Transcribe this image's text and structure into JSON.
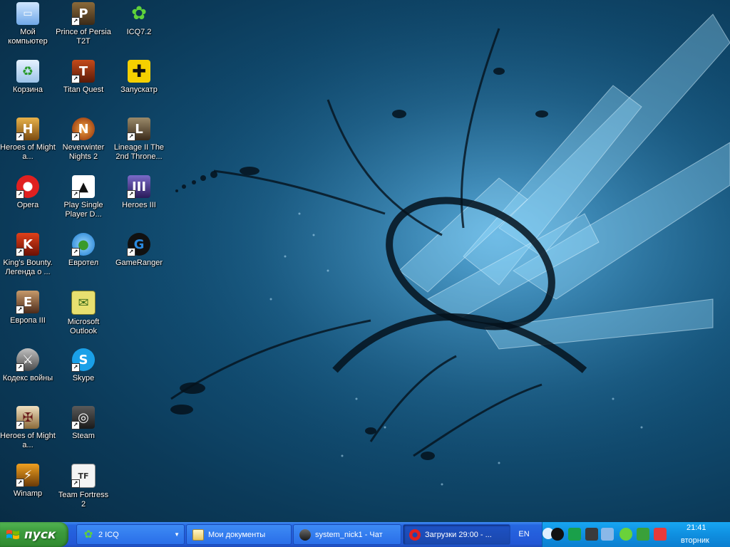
{
  "desktop": {
    "icons": [
      {
        "label": "Мой компьютер",
        "icon": "my-computer-icon"
      },
      {
        "label": "Prince of Persia T2T",
        "icon": "prince-of-persia-icon"
      },
      {
        "label": "ICQ7.2",
        "icon": "icq-flower-icon"
      },
      {
        "label": "Корзина",
        "icon": "recycle-bin-icon"
      },
      {
        "label": "Titan Quest",
        "icon": "titan-quest-icon"
      },
      {
        "label": "Запускатр",
        "icon": "zapuskatr-icon"
      },
      {
        "label": "Heroes of Might a...",
        "icon": "heroes-of-might-icon"
      },
      {
        "label": "Neverwinter Nights 2",
        "icon": "neverwinter-nights-icon"
      },
      {
        "label": "Lineage II The 2nd Throne...",
        "icon": "lineage-icon"
      },
      {
        "label": "Opera",
        "icon": "opera-icon"
      },
      {
        "label": "Play Single Player D...",
        "icon": "play-single-player-icon"
      },
      {
        "label": "Heroes III",
        "icon": "heroes-iii-icon"
      },
      {
        "label": "King's Bounty. Легенда о ...",
        "icon": "kings-bounty-icon"
      },
      {
        "label": "Евротел",
        "icon": "evrotel-globe-icon"
      },
      {
        "label": "GameRanger",
        "icon": "gameranger-icon"
      },
      {
        "label": "Европа III",
        "icon": "europa-iii-icon"
      },
      {
        "label": "Microsoft Outlook",
        "icon": "outlook-icon"
      },
      {
        "label": "Кодекс войны",
        "icon": "kodeks-voiny-icon"
      },
      {
        "label": "Skype",
        "icon": "skype-icon"
      },
      {
        "label": "Heroes of Might a...",
        "icon": "heroes-of-might-2-icon"
      },
      {
        "label": "Steam",
        "icon": "steam-icon"
      },
      {
        "label": "Winamp",
        "icon": "winamp-icon"
      },
      {
        "label": "Team Fortress 2",
        "icon": "team-fortress-icon"
      }
    ]
  },
  "taskbar": {
    "start_label": "пуск",
    "tasks": [
      {
        "label": "2 ICQ",
        "icon": "icq-flower-icon"
      },
      {
        "label": "Мои документы",
        "icon": "folder-icon"
      },
      {
        "label": "system_nick1 - Чат",
        "icon": "steam-icon"
      },
      {
        "label": "Загрузки 29:00 - ...",
        "icon": "opera-icon"
      }
    ],
    "lang": "EN",
    "clock_time": "21:41",
    "clock_day": "вторник"
  },
  "colors": {
    "desktop_bg": "#14557d",
    "taskbar": "#245edc",
    "start_button": "#3c9b3c",
    "tray": "#0f8fe0"
  }
}
